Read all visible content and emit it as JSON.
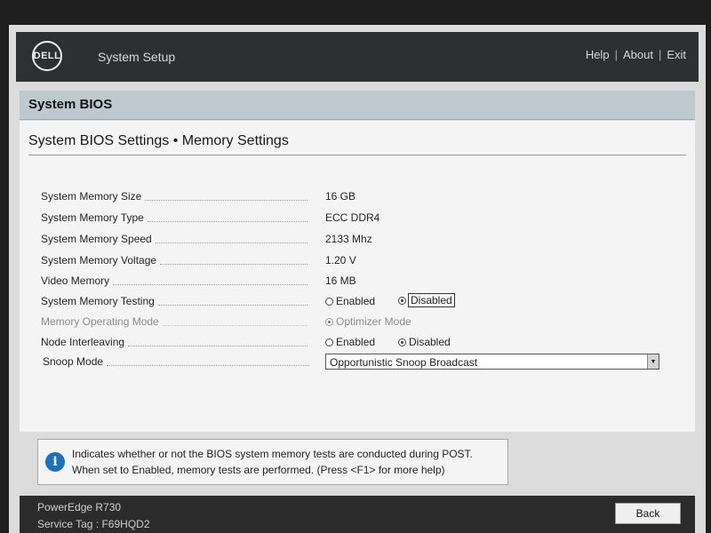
{
  "header": {
    "logo_text": "DELL",
    "title": "System Setup",
    "links": [
      "Help",
      "About",
      "Exit"
    ]
  },
  "section_title": "System BIOS",
  "page_subtitle": "System BIOS Settings • Memory Settings",
  "settings": [
    {
      "label": "System Memory Size",
      "value": "16 GB"
    },
    {
      "label": "System Memory Type",
      "value": "ECC DDR4"
    },
    {
      "label": "System Memory Speed",
      "value": "2133 Mhz"
    },
    {
      "label": "System Memory Voltage",
      "value": "1.20 V"
    },
    {
      "label": "Video Memory",
      "value": "16 MB"
    },
    {
      "label": "System Memory Testing",
      "options": [
        "Enabled",
        "Disabled"
      ],
      "selected": "Disabled"
    },
    {
      "label": "Memory Operating Mode",
      "options": [
        "Optimizer Mode"
      ],
      "selected": "Optimizer Mode",
      "disabled": true
    },
    {
      "label": "Node Interleaving",
      "options": [
        "Enabled",
        "Disabled"
      ],
      "selected": "Disabled"
    },
    {
      "label": "Snoop Mode",
      "dropdown_value": "Opportunistic Snoop Broadcast"
    }
  ],
  "help": {
    "line1": "Indicates whether or not the BIOS system memory tests are conducted during POST.",
    "line2": "When set to Enabled, memory tests are performed. (Press <F1> for more help)"
  },
  "footer": {
    "model": "PowerEdge R730",
    "service_tag": "Service Tag : F69HQD2",
    "back_label": "Back"
  }
}
